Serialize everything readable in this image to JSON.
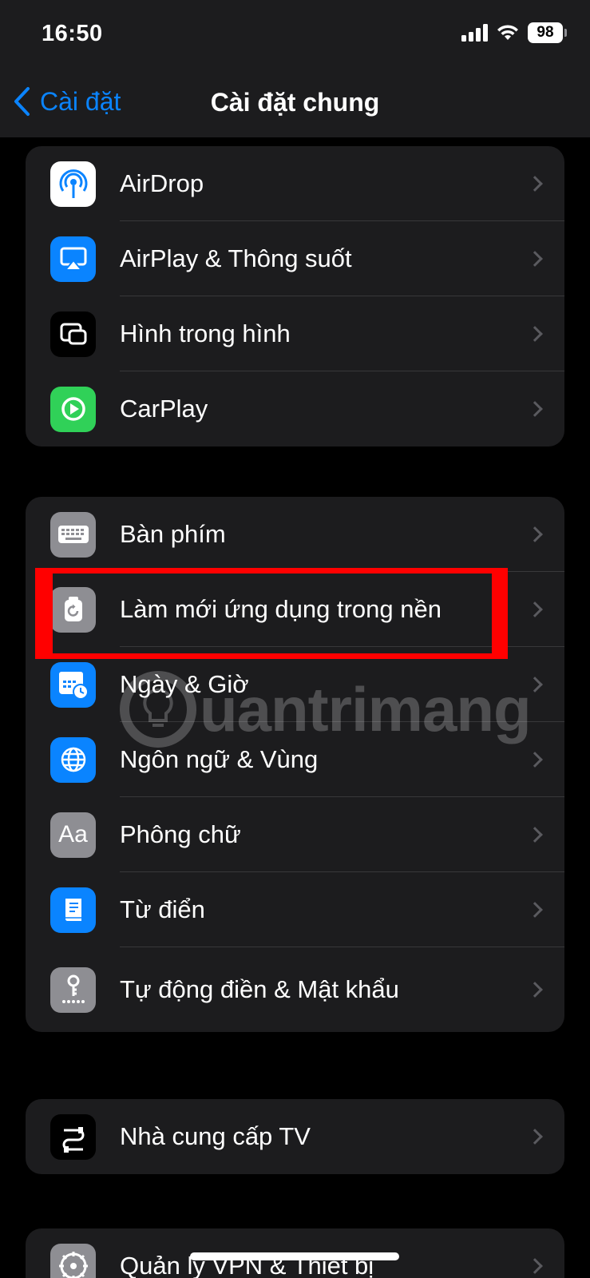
{
  "status": {
    "time": "16:50",
    "battery": "98"
  },
  "nav": {
    "back_label": "Cài đặt",
    "title": "Cài đặt chung"
  },
  "groups": [
    {
      "items": [
        {
          "label": "AirDrop",
          "icon": "airdrop-icon",
          "color": "#ffffff"
        },
        {
          "label": "AirPlay & Thông suốt",
          "icon": "airplay-icon",
          "color": "#0a84ff"
        },
        {
          "label": "Hình trong hình",
          "icon": "picture-in-picture-icon",
          "color": "#000000"
        },
        {
          "label": "CarPlay",
          "icon": "carplay-icon",
          "color": "#30d158"
        }
      ]
    },
    {
      "items": [
        {
          "label": "Bàn phím",
          "icon": "keyboard-icon",
          "color": "#8e8e93"
        },
        {
          "label": "Làm mới ứng dụng trong nền",
          "icon": "background-refresh-icon",
          "color": "#8e8e93"
        },
        {
          "label": "Ngày & Giờ",
          "icon": "calendar-clock-icon",
          "color": "#0a84ff"
        },
        {
          "label": "Ngôn ngữ & Vùng",
          "icon": "globe-icon",
          "color": "#0a84ff"
        },
        {
          "label": "Phông chữ",
          "icon": "font-icon",
          "color": "#8e8e93"
        },
        {
          "label": "Từ điển",
          "icon": "dictionary-icon",
          "color": "#0a84ff"
        },
        {
          "label": "Tự động điền & Mật khẩu",
          "icon": "key-icon",
          "color": "#8e8e93"
        }
      ]
    },
    {
      "items": [
        {
          "label": "Nhà cung cấp TV",
          "icon": "tv-provider-icon",
          "color": "#000000"
        }
      ]
    },
    {
      "items": [
        {
          "label": "Quản lý VPN & Thiết bị",
          "icon": "gear-icon",
          "color": "#8e8e93"
        }
      ]
    }
  ],
  "icons": {
    "font_glyph": "Aa"
  },
  "watermark": {
    "text": "uantrimang"
  }
}
